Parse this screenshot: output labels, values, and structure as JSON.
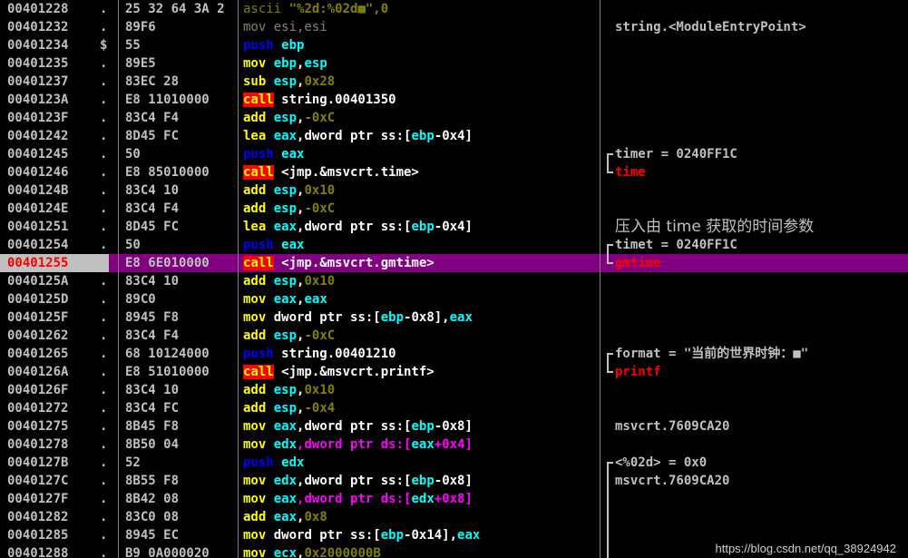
{
  "colors": {
    "background": "#000000",
    "address": "#c0c0c0",
    "push": "#0000ff",
    "mnemonic": "#ffff00",
    "call_bg": "#ff0000",
    "register": "#00ffff",
    "number": "#808000",
    "memory": "#ffffff",
    "memory_ds": "#ff00ff",
    "highlight_row": "#800080",
    "comment": "#c0c0c0",
    "comment_red": "#ff0000"
  },
  "rows": [
    {
      "addr": "00401228",
      "flag": ".",
      "hex": "25 32 64 3A 2",
      "asm": [
        [
          "ascii",
          "m-ascii"
        ],
        [
          " \"%2d:%02d■\",0",
          "o-str"
        ]
      ],
      "comment": "",
      "bracket": ""
    },
    {
      "addr": "00401232",
      "flag": ".",
      "hex": "89F6",
      "asm": [
        [
          "mov esi,esi",
          "m-movfaint"
        ]
      ],
      "comment": "string.<ModuleEntryPoint>",
      "bracket": ""
    },
    {
      "addr": "00401234",
      "flag": "$",
      "hex": "55",
      "asm": [
        [
          "push",
          "m-push"
        ],
        [
          " ",
          "o-white"
        ],
        [
          "ebp",
          "o-reg"
        ]
      ],
      "comment": "",
      "bracket": ""
    },
    {
      "addr": "00401235",
      "flag": ".",
      "hex": "89E5",
      "asm": [
        [
          "mov",
          "m-mov"
        ],
        [
          " ",
          "o-white"
        ],
        [
          "ebp",
          "o-reg"
        ],
        [
          ",",
          "o-white"
        ],
        [
          "esp",
          "o-reg"
        ]
      ],
      "comment": "",
      "bracket": ""
    },
    {
      "addr": "00401237",
      "flag": ".",
      "hex": "83EC 28",
      "asm": [
        [
          "sub",
          "m-sub"
        ],
        [
          " ",
          "o-white"
        ],
        [
          "esp",
          "o-reg"
        ],
        [
          ",",
          "o-white"
        ],
        [
          "0x28",
          "o-num"
        ]
      ],
      "comment": "",
      "bracket": ""
    },
    {
      "addr": "0040123A",
      "flag": ".",
      "hex": "E8 11010000",
      "asm": [
        [
          "call",
          "m-call"
        ],
        [
          " string.00401350",
          "o-white"
        ]
      ],
      "comment": "",
      "bracket": ""
    },
    {
      "addr": "0040123F",
      "flag": ".",
      "hex": "83C4 F4",
      "asm": [
        [
          "add",
          "m-add"
        ],
        [
          " ",
          "o-white"
        ],
        [
          "esp",
          "o-reg"
        ],
        [
          ",",
          "o-white"
        ],
        [
          "-0xC",
          "o-num"
        ]
      ],
      "comment": "",
      "bracket": ""
    },
    {
      "addr": "00401242",
      "flag": ".",
      "hex": "8D45 FC",
      "asm": [
        [
          "lea",
          "m-lea"
        ],
        [
          " ",
          "o-white"
        ],
        [
          "eax",
          "o-reg"
        ],
        [
          ",dword ptr ss:[",
          "o-mem"
        ],
        [
          "ebp",
          "o-reg"
        ],
        [
          "-0x4]",
          "o-mem"
        ]
      ],
      "comment": "",
      "bracket": ""
    },
    {
      "addr": "00401245",
      "flag": ".",
      "hex": "50",
      "asm": [
        [
          "push",
          "m-push"
        ],
        [
          " ",
          "o-white"
        ],
        [
          "eax",
          "o-reg"
        ]
      ],
      "comment": "timer = 0240FF1C",
      "bracket": "top"
    },
    {
      "addr": "00401246",
      "flag": ".",
      "hex": "E8 85010000",
      "asm": [
        [
          "call",
          "m-call"
        ],
        [
          " <jmp.&msvcrt.time>",
          "o-white"
        ]
      ],
      "comment": "time",
      "commentRed": true,
      "bracket": "bottom"
    },
    {
      "addr": "0040124B",
      "flag": ".",
      "hex": "83C4 10",
      "asm": [
        [
          "add",
          "m-add"
        ],
        [
          " ",
          "o-white"
        ],
        [
          "esp",
          "o-reg"
        ],
        [
          ",",
          "o-white"
        ],
        [
          "0x10",
          "o-num"
        ]
      ],
      "comment": "",
      "bracket": ""
    },
    {
      "addr": "0040124E",
      "flag": ".",
      "hex": "83C4 F4",
      "asm": [
        [
          "add",
          "m-add"
        ],
        [
          " ",
          "o-white"
        ],
        [
          "esp",
          "o-reg"
        ],
        [
          ",",
          "o-white"
        ],
        [
          "-0xC",
          "o-num"
        ]
      ],
      "comment": "",
      "bracket": ""
    },
    {
      "addr": "00401251",
      "flag": ".",
      "hex": "8D45 FC",
      "asm": [
        [
          "lea",
          "m-lea"
        ],
        [
          " ",
          "o-white"
        ],
        [
          "eax",
          "o-reg"
        ],
        [
          ",dword ptr ss:[",
          "o-mem"
        ],
        [
          "ebp",
          "o-reg"
        ],
        [
          "-0x4]",
          "o-mem"
        ]
      ],
      "comment": "压入由 time 获取的时间参数",
      "commentBig": true,
      "bracket": ""
    },
    {
      "addr": "00401254",
      "flag": ".",
      "hex": "50",
      "asm": [
        [
          "push",
          "m-push"
        ],
        [
          " ",
          "o-white"
        ],
        [
          "eax",
          "o-reg"
        ]
      ],
      "comment": "timet = 0240FF1C",
      "bracket": "top"
    },
    {
      "addr": "00401255",
      "flag": ".",
      "hex": "E8 6E010000",
      "asm": [
        [
          "call",
          "m-call"
        ],
        [
          " <jmp.&msvcrt.gmtime>",
          "o-white"
        ]
      ],
      "comment": "gmtime",
      "commentRed": true,
      "bracket": "bottom",
      "highlight": true,
      "eip": true
    },
    {
      "addr": "0040125A",
      "flag": ".",
      "hex": "83C4 10",
      "asm": [
        [
          "add",
          "m-add"
        ],
        [
          " ",
          "o-white"
        ],
        [
          "esp",
          "o-reg"
        ],
        [
          ",",
          "o-white"
        ],
        [
          "0x10",
          "o-num"
        ]
      ],
      "comment": "",
      "bracket": ""
    },
    {
      "addr": "0040125D",
      "flag": ".",
      "hex": "89C0",
      "asm": [
        [
          "mov",
          "m-mov"
        ],
        [
          " ",
          "o-white"
        ],
        [
          "eax",
          "o-reg"
        ],
        [
          ",",
          "o-white"
        ],
        [
          "eax",
          "o-reg"
        ]
      ],
      "comment": "",
      "bracket": ""
    },
    {
      "addr": "0040125F",
      "flag": ".",
      "hex": "8945 F8",
      "asm": [
        [
          "mov",
          "m-mov"
        ],
        [
          " dword ptr ss:[",
          "o-mem"
        ],
        [
          "ebp",
          "o-reg"
        ],
        [
          "-0x8],",
          "o-mem"
        ],
        [
          "eax",
          "o-reg"
        ]
      ],
      "comment": "",
      "bracket": ""
    },
    {
      "addr": "00401262",
      "flag": ".",
      "hex": "83C4 F4",
      "asm": [
        [
          "add",
          "m-add"
        ],
        [
          " ",
          "o-white"
        ],
        [
          "esp",
          "o-reg"
        ],
        [
          ",",
          "o-white"
        ],
        [
          "-0xC",
          "o-num"
        ]
      ],
      "comment": "",
      "bracket": ""
    },
    {
      "addr": "00401265",
      "flag": ".",
      "hex": "68 10124000",
      "asm": [
        [
          "push",
          "m-push"
        ],
        [
          " string.00401210",
          "o-white"
        ]
      ],
      "comment": "format = \"当前的世界时钟：■\"",
      "commentCn": true,
      "bracket": "top"
    },
    {
      "addr": "0040126A",
      "flag": ".",
      "hex": "E8 51010000",
      "asm": [
        [
          "call",
          "m-call"
        ],
        [
          " <jmp.&msvcrt.printf>",
          "o-white"
        ]
      ],
      "comment": "printf",
      "commentRed": true,
      "bracket": "bottom"
    },
    {
      "addr": "0040126F",
      "flag": ".",
      "hex": "83C4 10",
      "asm": [
        [
          "add",
          "m-add"
        ],
        [
          " ",
          "o-white"
        ],
        [
          "esp",
          "o-reg"
        ],
        [
          ",",
          "o-white"
        ],
        [
          "0x10",
          "o-num"
        ]
      ],
      "comment": "",
      "bracket": ""
    },
    {
      "addr": "00401272",
      "flag": ".",
      "hex": "83C4 FC",
      "asm": [
        [
          "add",
          "m-add"
        ],
        [
          " ",
          "o-white"
        ],
        [
          "esp",
          "o-reg"
        ],
        [
          ",",
          "o-white"
        ],
        [
          "-0x4",
          "o-num"
        ]
      ],
      "comment": "",
      "bracket": ""
    },
    {
      "addr": "00401275",
      "flag": ".",
      "hex": "8B45 F8",
      "asm": [
        [
          "mov",
          "m-mov"
        ],
        [
          " ",
          "o-white"
        ],
        [
          "eax",
          "o-reg"
        ],
        [
          ",dword ptr ss:[",
          "o-mem"
        ],
        [
          "ebp",
          "o-reg"
        ],
        [
          "-0x8]",
          "o-mem"
        ]
      ],
      "comment": "msvcrt.7609CA20",
      "bracket": ""
    },
    {
      "addr": "00401278",
      "flag": ".",
      "hex": "8B50 04",
      "asm": [
        [
          "mov",
          "m-mov"
        ],
        [
          " ",
          "o-white"
        ],
        [
          "edx",
          "o-reg"
        ],
        [
          ",dword ptr ds:[",
          "o-mem2"
        ],
        [
          "eax",
          "o-reg"
        ],
        [
          "+0x4]",
          "o-mem2"
        ]
      ],
      "comment": "",
      "bracket": ""
    },
    {
      "addr": "0040127B",
      "flag": ".",
      "hex": "52",
      "asm": [
        [
          "push",
          "m-push"
        ],
        [
          " ",
          "o-white"
        ],
        [
          "edx",
          "o-reg"
        ]
      ],
      "comment": "<%02d> = 0x0",
      "bracket": "top"
    },
    {
      "addr": "0040127C",
      "flag": ".",
      "hex": "8B55 F8",
      "asm": [
        [
          "mov",
          "m-mov"
        ],
        [
          " ",
          "o-white"
        ],
        [
          "edx",
          "o-reg"
        ],
        [
          ",dword ptr ss:[",
          "o-mem"
        ],
        [
          "ebp",
          "o-reg"
        ],
        [
          "-0x8]",
          "o-mem"
        ]
      ],
      "comment": "msvcrt.7609CA20",
      "bracket": "mid"
    },
    {
      "addr": "0040127F",
      "flag": ".",
      "hex": "8B42 08",
      "asm": [
        [
          "mov",
          "m-mov"
        ],
        [
          " ",
          "o-white"
        ],
        [
          "eax",
          "o-reg"
        ],
        [
          ",dword ptr ds:[",
          "o-mem2"
        ],
        [
          "edx",
          "o-reg"
        ],
        [
          "+0x8]",
          "o-mem2"
        ]
      ],
      "comment": "",
      "bracket": "mid"
    },
    {
      "addr": "00401282",
      "flag": ".",
      "hex": "83C0 08",
      "asm": [
        [
          "add",
          "m-add"
        ],
        [
          " ",
          "o-white"
        ],
        [
          "eax",
          "o-reg"
        ],
        [
          ",",
          "o-white"
        ],
        [
          "0x8",
          "o-num"
        ]
      ],
      "comment": "",
      "bracket": "mid"
    },
    {
      "addr": "00401285",
      "flag": ".",
      "hex": "8945 EC",
      "asm": [
        [
          "mov",
          "m-mov"
        ],
        [
          " dword ptr ss:[",
          "o-mem"
        ],
        [
          "ebp",
          "o-reg"
        ],
        [
          "-0x14],",
          "o-mem"
        ],
        [
          "eax",
          "o-reg"
        ]
      ],
      "comment": "",
      "bracket": "mid"
    },
    {
      "addr": "00401288",
      "flag": ".",
      "hex": "B9 0A000020",
      "asm": [
        [
          "mov",
          "m-mov"
        ],
        [
          " ",
          "o-white"
        ],
        [
          "ecx",
          "o-reg"
        ],
        [
          ",",
          "o-white"
        ],
        [
          "0x2000000B",
          "o-num"
        ]
      ],
      "comment": "",
      "bracket": "mid"
    }
  ],
  "watermark": "https://blog.csdn.net/qq_38924942"
}
